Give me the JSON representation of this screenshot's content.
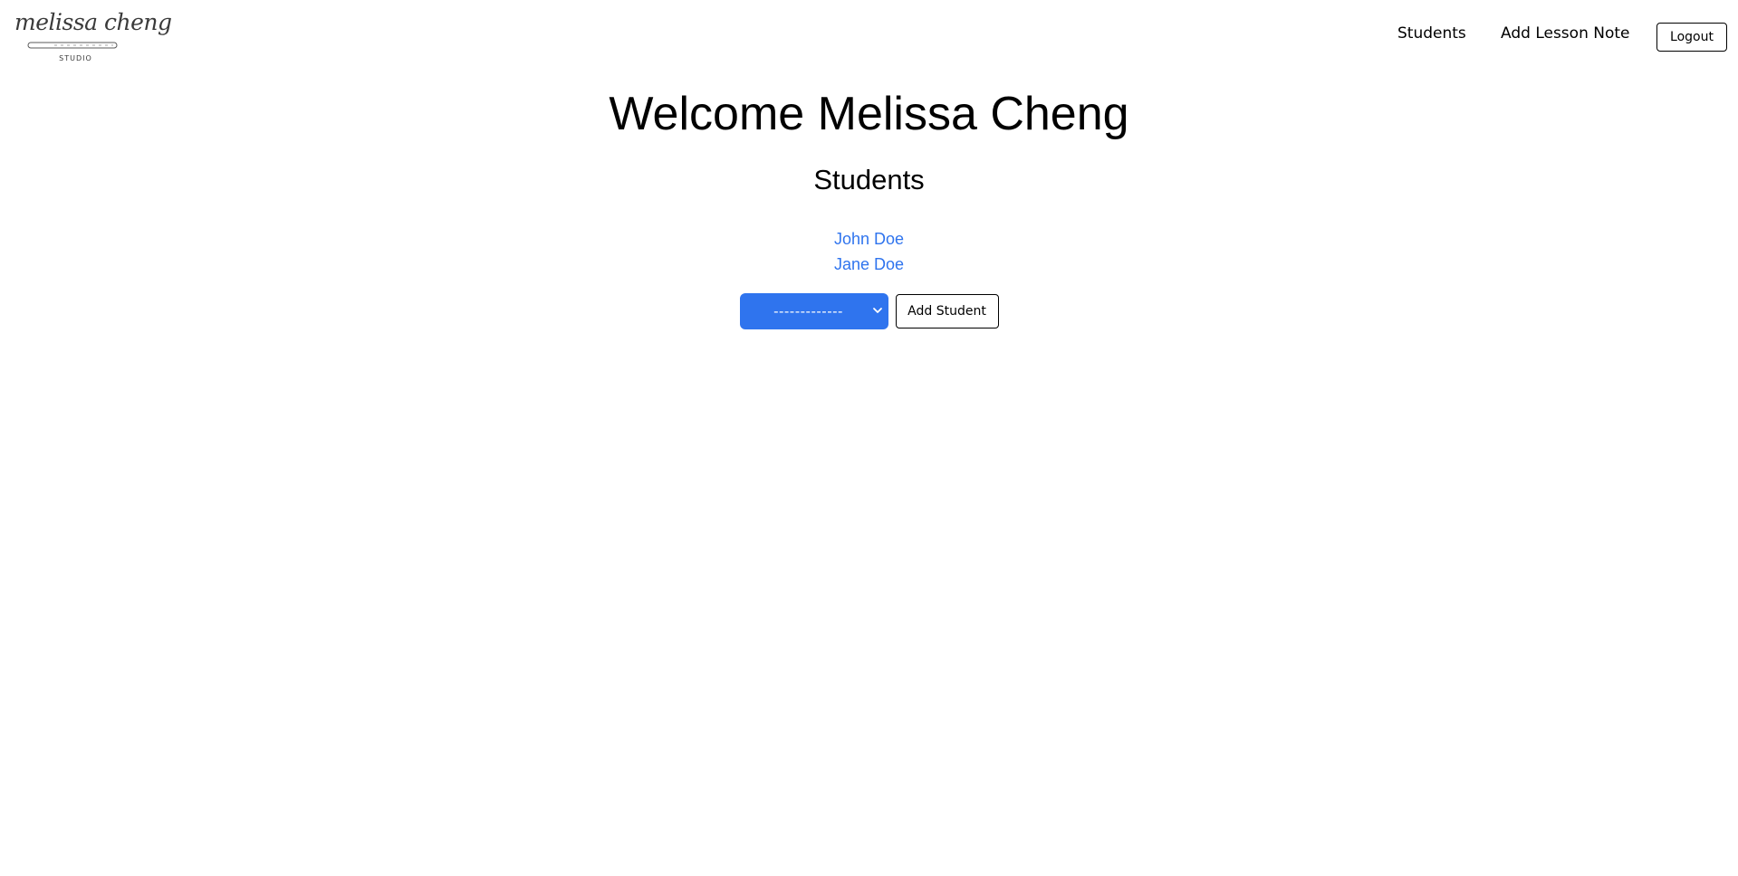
{
  "brand": {
    "logo_script": "melissa cheng",
    "logo_subtext": "STUDIO"
  },
  "nav": {
    "students_label": "Students",
    "add_lesson_note_label": "Add Lesson Note",
    "logout_label": "Logout"
  },
  "main": {
    "welcome_title": "Welcome Melissa Cheng",
    "students_heading": "Students",
    "students": [
      {
        "name": "John Doe"
      },
      {
        "name": "Jane Doe"
      }
    ],
    "student_select": {
      "selected_value": "-------------"
    },
    "add_student_label": "Add Student"
  },
  "colors": {
    "accent": "#2f74ee",
    "text": "#000000",
    "background": "#ffffff"
  },
  "icons": {
    "dropdown": "chevron-down-icon",
    "logo_flute": "flute-icon"
  }
}
